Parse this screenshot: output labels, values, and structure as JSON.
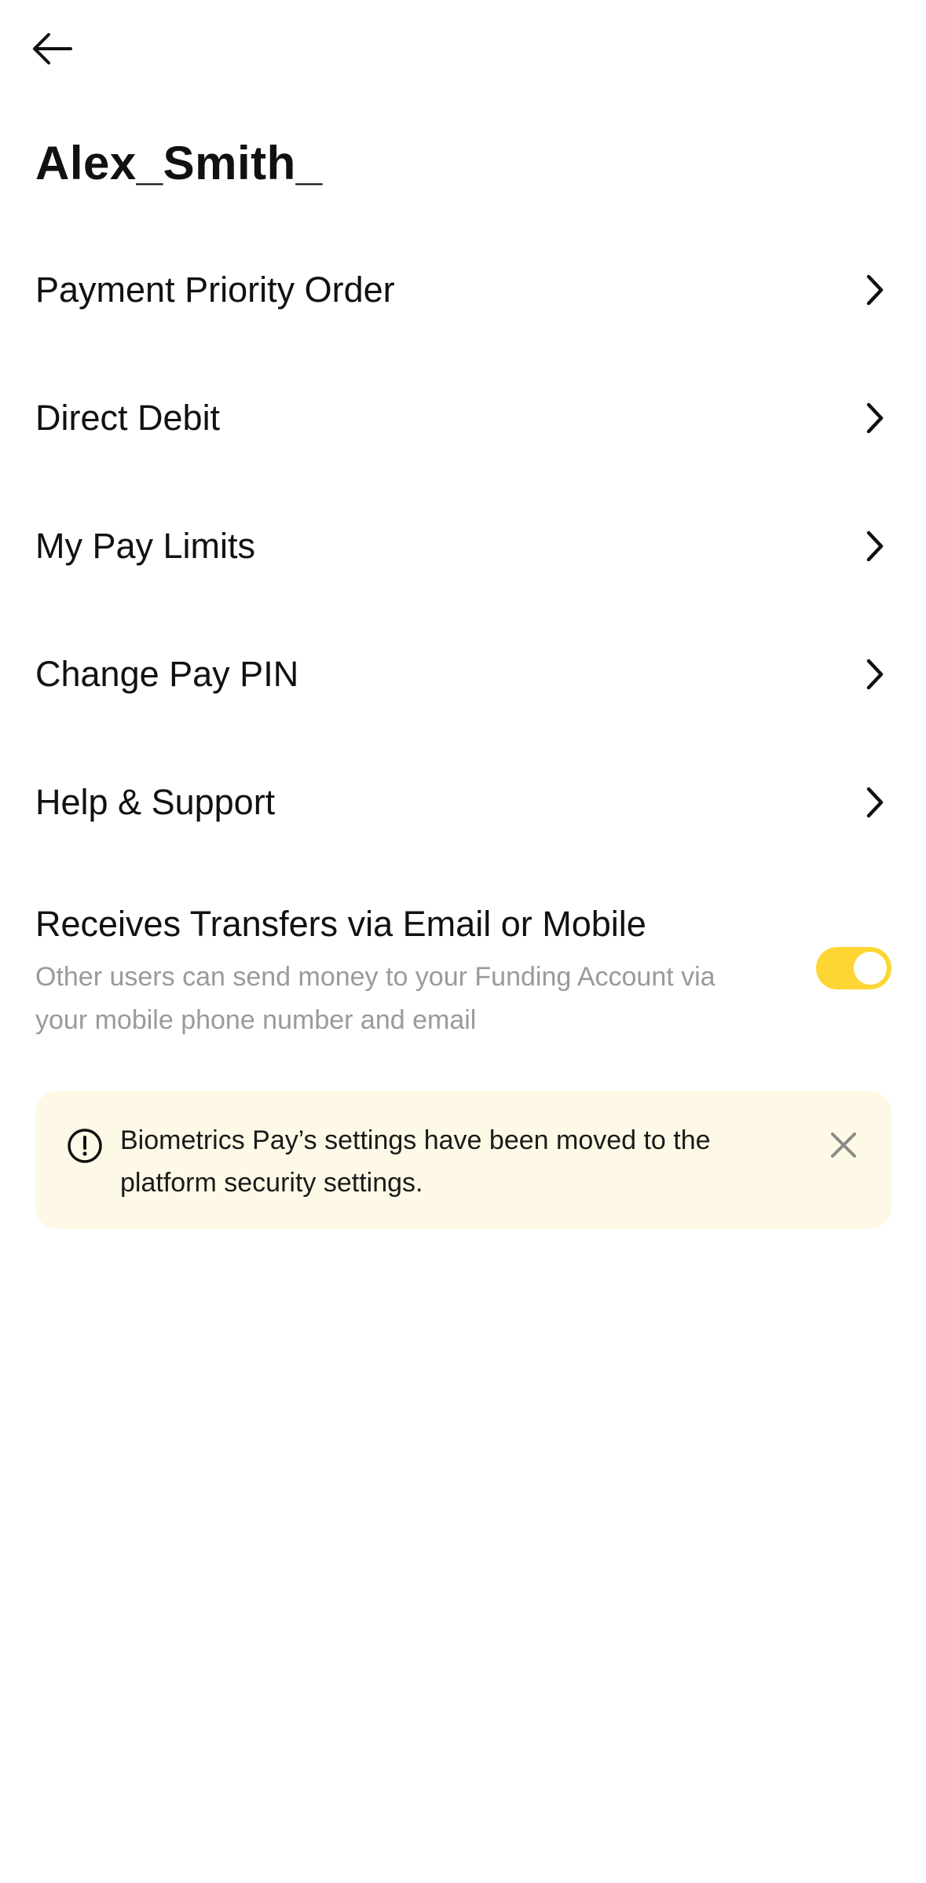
{
  "header": {
    "back_icon": "arrow-left-icon",
    "title": "Alex_Smith_"
  },
  "menu": {
    "items": [
      {
        "label": "Payment Priority Order",
        "icon": "chevron-right-icon"
      },
      {
        "label": "Direct Debit",
        "icon": "chevron-right-icon"
      },
      {
        "label": "My Pay Limits",
        "icon": "chevron-right-icon"
      },
      {
        "label": "Change Pay PIN",
        "icon": "chevron-right-icon"
      },
      {
        "label": "Help & Support",
        "icon": "chevron-right-icon"
      }
    ]
  },
  "transfers": {
    "title": "Receives Transfers via Email or Mobile",
    "description": "Other users can send money to your Funding Account via your mobile phone number and email",
    "enabled": true
  },
  "notice": {
    "icon": "alert-circle-icon",
    "text": "Biometrics Pay’s settings have been moved to the platform security settings.",
    "close_icon": "close-icon"
  },
  "colors": {
    "accent": "#fdd633",
    "notice_background": "#fef9e6",
    "secondary_text": "#9a9a9a"
  }
}
